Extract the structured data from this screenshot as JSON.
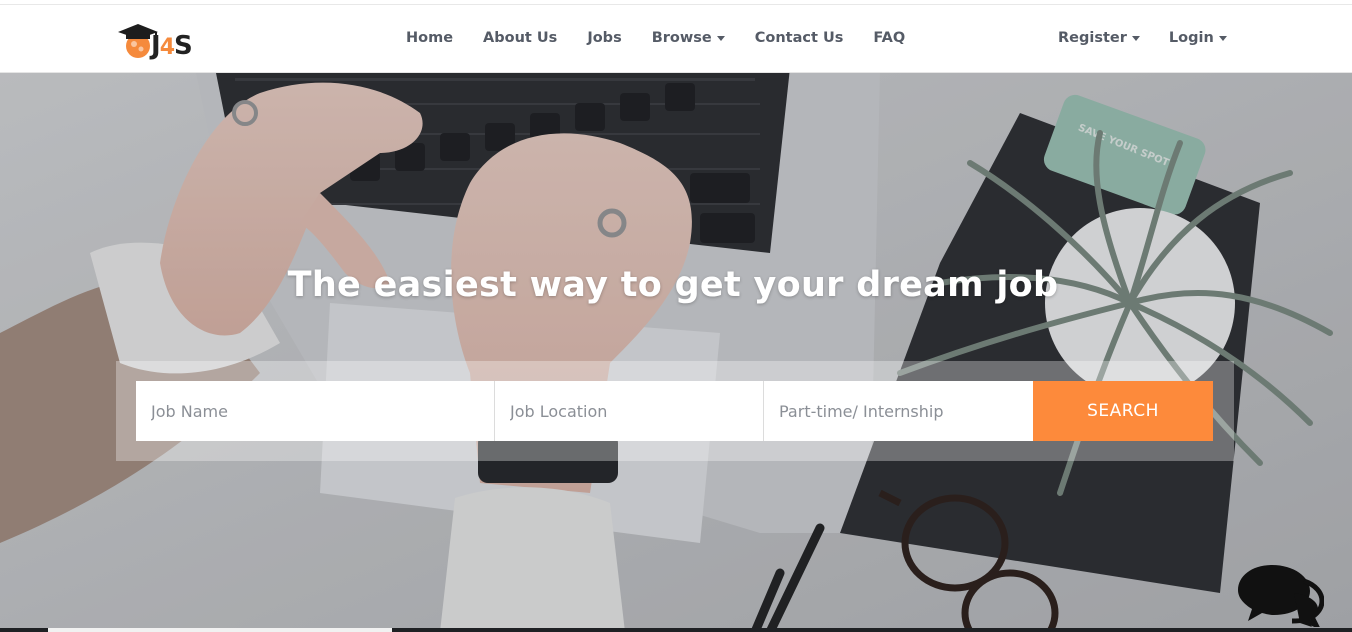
{
  "brand": {
    "logo_text_left": "J",
    "logo_text_mid": "4",
    "logo_text_right": "S",
    "accent_color": "#fd8a3b"
  },
  "nav": {
    "items": [
      {
        "label": "Home"
      },
      {
        "label": "About Us"
      },
      {
        "label": "Jobs"
      },
      {
        "label": "Browse",
        "dropdown": true
      },
      {
        "label": "Contact Us"
      },
      {
        "label": "FAQ"
      }
    ],
    "auth": [
      {
        "label": "Register",
        "dropdown": true
      },
      {
        "label": "Login",
        "dropdown": true
      }
    ]
  },
  "hero": {
    "headline": "The easiest way to get your dream job",
    "search": {
      "job_name_placeholder": "Job Name",
      "job_location_placeholder": "Job Location",
      "job_type_placeholder": "Part-time/ Internship",
      "button_label": "SEARCH"
    },
    "notebook_text": "SAVE YOUR SPOT"
  },
  "icons": {
    "logo": "graduation-cap-logo-icon",
    "caret": "caret-down-icon",
    "chat": "chat-bubbles-icon"
  }
}
